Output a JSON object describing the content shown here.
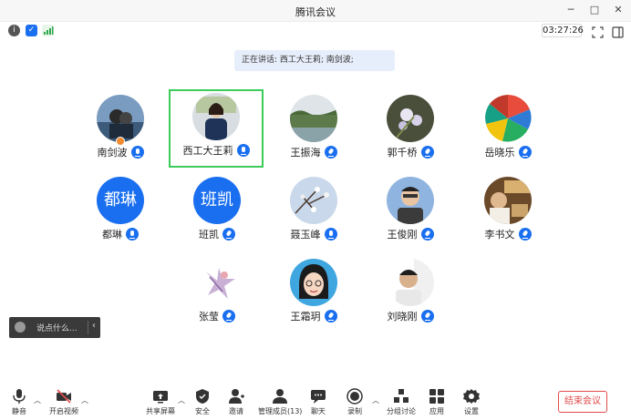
{
  "window": {
    "title": "腾讯会议",
    "minimize": "─",
    "maximize": "□",
    "close": "✕"
  },
  "status": {
    "timer": "03:27:26"
  },
  "speaking": {
    "text": "正在讲话: 西工大王莉; 南剑波;"
  },
  "participants": [
    {
      "name": "南剑波",
      "avatar": "photo",
      "mic": "on",
      "host": true
    },
    {
      "name": "西工大王莉",
      "avatar": "photo",
      "mic": "on",
      "active": true
    },
    {
      "name": "王振海",
      "avatar": "photo",
      "mic": "muted"
    },
    {
      "name": "郭千桥",
      "avatar": "photo",
      "mic": "muted"
    },
    {
      "name": "岳晓乐",
      "avatar": "photo",
      "mic": "muted"
    },
    {
      "name": "都琳",
      "avatar_text": "都琳",
      "mic": "on"
    },
    {
      "name": "班凯",
      "avatar_text": "班凯",
      "mic": "muted"
    },
    {
      "name": "聂玉峰",
      "avatar": "photo",
      "mic": "on"
    },
    {
      "name": "王俊刚",
      "avatar": "photo",
      "mic": "muted"
    },
    {
      "name": "李书文",
      "avatar": "photo",
      "mic": "muted"
    },
    {
      "name": "张莹",
      "avatar": "photo",
      "mic": "muted"
    },
    {
      "name": "王霜玥",
      "avatar": "photo",
      "mic": "muted"
    },
    {
      "name": "刘晓刚",
      "avatar": "photo",
      "mic": "muted"
    }
  ],
  "chat": {
    "placeholder": "说点什么..."
  },
  "toolbar": {
    "mute": "静音",
    "video": "开启视频",
    "share": "共享屏幕",
    "security": "安全",
    "invite": "邀请",
    "members": "管理成员(13)",
    "chat": "聊天",
    "record": "录制",
    "breakout": "分组讨论",
    "apps": "应用",
    "settings": "设置",
    "end": "结束会议"
  },
  "colors": {
    "accent": "#1a6ff0",
    "active_border": "#3ccc5a",
    "end": "#e14b4b"
  }
}
